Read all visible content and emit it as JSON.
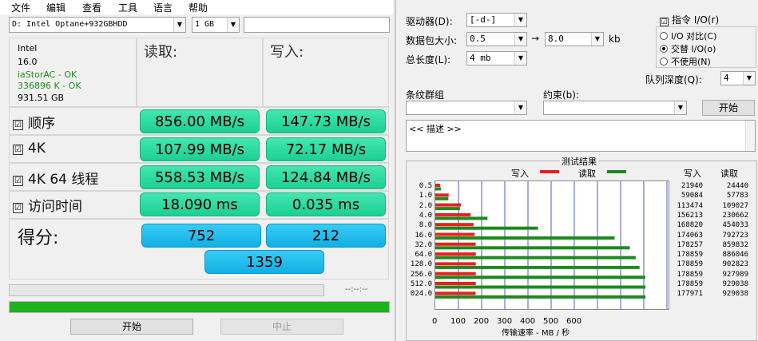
{
  "asssd": {
    "menu": [
      "文件",
      "编辑",
      "查看",
      "工具",
      "语言",
      "帮助"
    ],
    "drive_select": "D: Intel Optane+932GBHDD",
    "size_select": "1 GB",
    "info": [
      "Intel",
      "16.0",
      "iaStorAC - OK",
      "336896 K - OK",
      "931.51 GB"
    ],
    "info_colors": [
      "#000000",
      "#000000",
      "#1c8a1c",
      "#1c8a1c",
      "#000000"
    ],
    "read_header": "读取:",
    "write_header": "写入:",
    "rows": [
      {
        "label": "顺序",
        "check": "☑",
        "read": "856.00 MB/s",
        "write": "147.73 MB/s"
      },
      {
        "label": "4K",
        "check": "☑",
        "read": "107.99 MB/s",
        "write": "72.17 MB/s"
      },
      {
        "label": "4K 64 线程",
        "check": "☑",
        "read": "558.53 MB/s",
        "write": "124.84 MB/s"
      },
      {
        "label": "访问时间",
        "check": "☑",
        "read": "18.090 ms",
        "write": "0.035 ms"
      }
    ],
    "score_label": "得分:",
    "score_read": "752",
    "score_write": "212",
    "score_total": "1359",
    "time_readout": "--:--:--",
    "progress": 1.0,
    "start_button": "开始",
    "stop_button": "中止"
  },
  "atto": {
    "drive_label": "驱动器(D):",
    "drive_value": "[-d-]",
    "transfer_label": "数据包大小:",
    "transfer_from": "0.5",
    "transfer_to": "8.0",
    "transfer_unit": "kb",
    "arrow": "→",
    "length_label": "总长度(L):",
    "length_value": "4 mb",
    "direct_io": "指令 I/O(r)",
    "direct_io_checked": "☑",
    "io_compare": "I/O 对比(C)",
    "overlapped_io": "交替 I/O(o)",
    "neither": "不使用(N)",
    "queue_label": "队列深度(Q):",
    "queue_value": "4",
    "stripe_label": "条纹群组",
    "restrict_label": "约束(b):",
    "start_button": "开始",
    "description": "<< 描述 >>",
    "results_title": "测试结果",
    "legend_write": "写入",
    "legend_read": "读取",
    "col_write": "写入",
    "col_read": "读取",
    "write_color": "#e8201c",
    "read_color": "#1d8a1d",
    "x_axis_label": "传输速率 - MB / 秒",
    "x_ticks": [
      "0",
      "100",
      "200",
      "300",
      "400",
      "500",
      "600"
    ],
    "chart_data": {
      "type": "bar",
      "categories": [
        "0.5",
        "1.0",
        "2.0",
        "4.0",
        "8.0",
        "16.0",
        "32.0",
        "64.0",
        "128.0",
        "256.0",
        "512.0",
        "1024.0"
      ],
      "category_labels": [
        "0.5",
        "1.0",
        "2.0",
        "4.0",
        "8.0",
        "16.0",
        "32.0",
        "64.0",
        "128.0",
        "256.0",
        "512.0",
        "024.0"
      ],
      "series": [
        {
          "name": "写入",
          "values": [
            21940,
            59084,
            113474,
            156213,
            168820,
            174063,
            178257,
            178859,
            178859,
            178859,
            178859,
            177971
          ]
        },
        {
          "name": "读取",
          "values": [
            24440,
            57783,
            109027,
            230662,
            454033,
            792723,
            859832,
            886046,
            902823,
            927989,
            929038,
            929038
          ]
        }
      ],
      "xlabel": "传输速率 - MB / 秒"
    }
  }
}
